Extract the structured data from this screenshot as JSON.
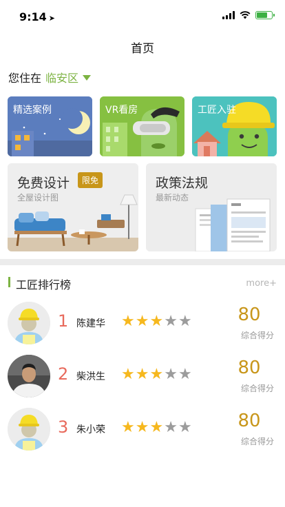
{
  "status": {
    "time": "9:14"
  },
  "nav": {
    "title": "首页"
  },
  "location": {
    "prefix": "您住在",
    "district": "临安区"
  },
  "categories": [
    {
      "label": "精选案例"
    },
    {
      "label": "VR看房"
    },
    {
      "label": "工匠入驻"
    }
  ],
  "promos": [
    {
      "title": "免费设计",
      "tag": "限免",
      "subtitle": "全屋设计图"
    },
    {
      "title": "政策法规",
      "subtitle": "最新动态"
    }
  ],
  "ranking": {
    "title": "工匠排行榜",
    "more": "more+",
    "score_label": "综合得分",
    "items": [
      {
        "rank": "1",
        "name": "陈建华",
        "stars": 3,
        "max_stars": 5,
        "score": "80"
      },
      {
        "rank": "2",
        "name": "柴洪生",
        "stars": 3,
        "max_stars": 5,
        "score": "80"
      },
      {
        "rank": "3",
        "name": "朱小荣",
        "stars": 3,
        "max_stars": 5,
        "score": "80"
      }
    ]
  },
  "colors": {
    "accent": "#7cb342",
    "gold": "#c8961a",
    "rank_red": "#e86a5c",
    "star": "#f6b81e"
  }
}
